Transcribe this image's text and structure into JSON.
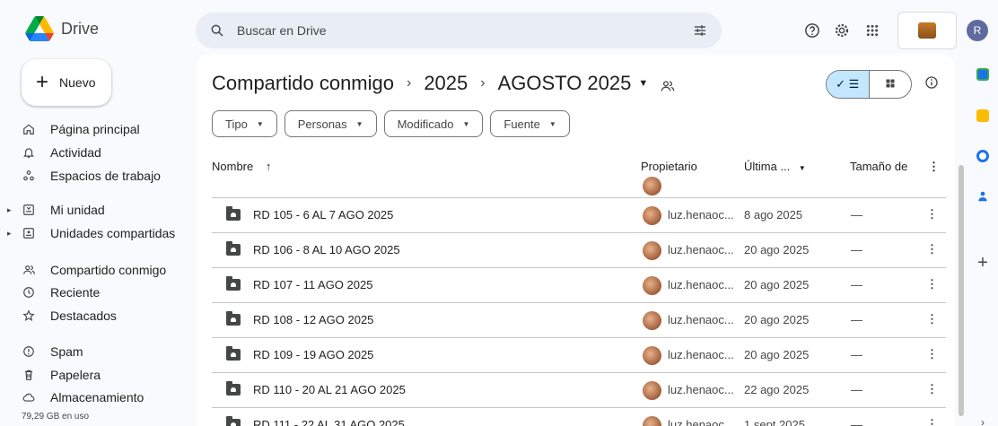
{
  "app": {
    "name": "Drive"
  },
  "search": {
    "placeholder": "Buscar en Drive"
  },
  "header": {
    "avatar_initial": "R"
  },
  "sidebar": {
    "new_label": "Nuevo",
    "items": [
      {
        "label": "Página principal",
        "icon": "home-icon"
      },
      {
        "label": "Actividad",
        "icon": "bell-icon"
      },
      {
        "label": "Espacios de trabajo",
        "icon": "workspaces-icon"
      },
      {
        "label": "Mi unidad",
        "icon": "drive-icon"
      },
      {
        "label": "Unidades compartidas",
        "icon": "shared-drives-icon"
      },
      {
        "label": "Compartido conmigo",
        "icon": "people-icon"
      },
      {
        "label": "Reciente",
        "icon": "clock-icon"
      },
      {
        "label": "Destacados",
        "icon": "star-icon"
      },
      {
        "label": "Spam",
        "icon": "spam-icon"
      },
      {
        "label": "Papelera",
        "icon": "trash-icon"
      },
      {
        "label": "Almacenamiento",
        "icon": "cloud-icon"
      }
    ],
    "storage_used": "79,29 GB en uso"
  },
  "breadcrumb": [
    "Compartido conmigo",
    "2025",
    "AGOSTO 2025"
  ],
  "filters": [
    "Tipo",
    "Personas",
    "Modificado",
    "Fuente"
  ],
  "table": {
    "columns": {
      "name": "Nombre",
      "owner": "Propietario",
      "modified": "Última ...",
      "size": "Tamaño de"
    },
    "rows": [
      {
        "name": "RD 105 - 6 AL 7 AGO 2025",
        "owner": "luz.henaoc...",
        "date": "8 ago 2025",
        "size": "—"
      },
      {
        "name": "RD 106 - 8 AL 10 AGO 2025",
        "owner": "luz.henaoc...",
        "date": "20 ago 2025",
        "size": "—"
      },
      {
        "name": "RD 107 - 11 AGO 2025",
        "owner": "luz.henaoc...",
        "date": "20 ago 2025",
        "size": "—"
      },
      {
        "name": "RD 108 - 12 AGO 2025",
        "owner": "luz.henaoc...",
        "date": "20 ago 2025",
        "size": "—"
      },
      {
        "name": "RD 109 - 19 AGO 2025",
        "owner": "luz.henaoc...",
        "date": "20 ago 2025",
        "size": "—"
      },
      {
        "name": "RD 110 - 20 AL 21 AGO 2025",
        "owner": "luz.henaoc...",
        "date": "22 ago 2025",
        "size": "—"
      },
      {
        "name": "RD 111 - 22 AL 31 AGO 2025",
        "owner": "luz.henaoc...",
        "date": "1 sept 2025",
        "size": "—"
      }
    ]
  },
  "colors": {
    "accent": "#c2e7ff",
    "search_bg": "#e9eef6",
    "page_bg": "#f8fafd"
  }
}
